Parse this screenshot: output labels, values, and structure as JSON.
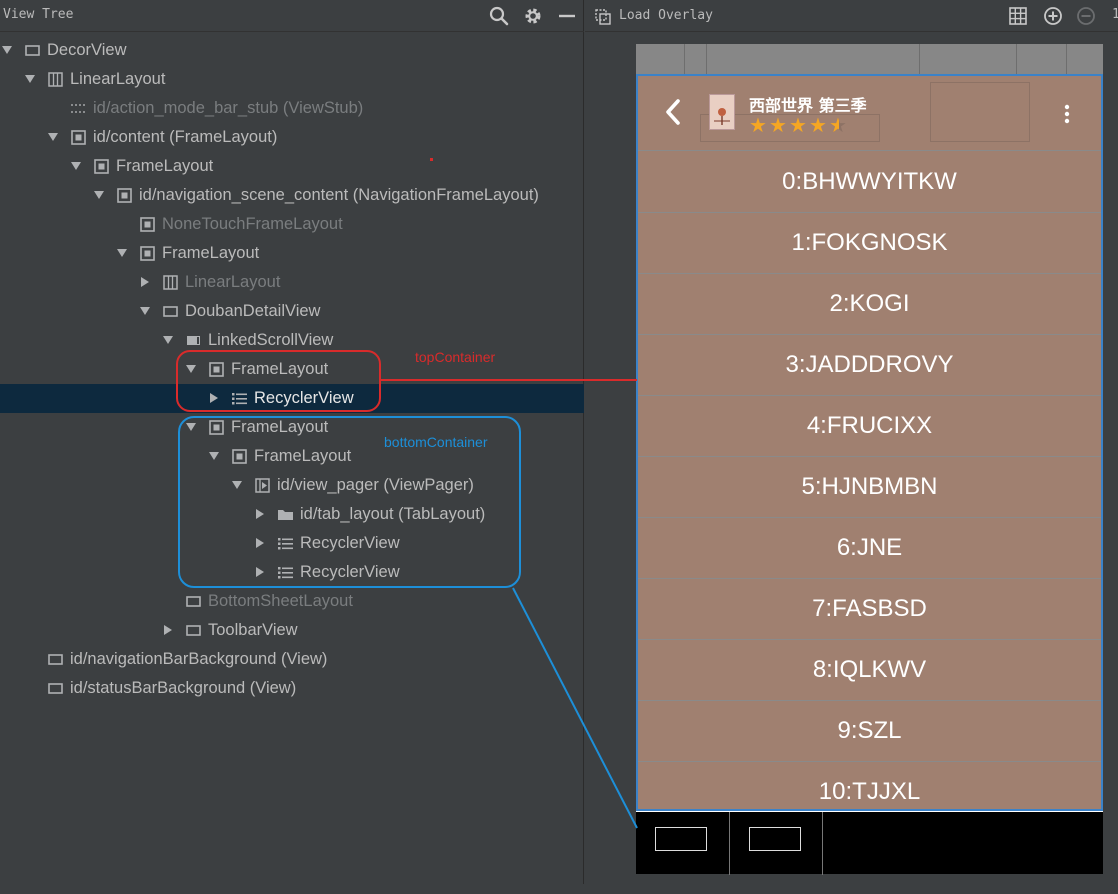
{
  "left_panel": {
    "title": "View Tree",
    "header_icons": [
      "search-icon",
      "gear-icon",
      "minimize-icon"
    ]
  },
  "tree": [
    {
      "label": "DecorView",
      "depth": 0,
      "arrow": "expanded",
      "icon": "view-icon",
      "style": "normal"
    },
    {
      "label": "LinearLayout",
      "depth": 1,
      "arrow": "expanded",
      "icon": "linear-layout-icon",
      "style": "normal"
    },
    {
      "label": "id/action_mode_bar_stub (ViewStub)",
      "depth": 2,
      "arrow": "none",
      "icon": "viewstub-icon",
      "style": "dim"
    },
    {
      "label": "id/content (FrameLayout)",
      "depth": 2,
      "arrow": "expanded",
      "icon": "frame-layout-icon",
      "style": "normal"
    },
    {
      "label": "FrameLayout",
      "depth": 3,
      "arrow": "expanded",
      "icon": "frame-layout-icon",
      "style": "normal"
    },
    {
      "label": "id/navigation_scene_content (NavigationFrameLayout)",
      "depth": 4,
      "arrow": "expanded",
      "icon": "frame-layout-icon",
      "style": "normal"
    },
    {
      "label": "NoneTouchFrameLayout",
      "depth": 5,
      "arrow": "none",
      "icon": "frame-layout-icon",
      "style": "dim"
    },
    {
      "label": "FrameLayout",
      "depth": 5,
      "arrow": "expanded",
      "icon": "frame-layout-icon",
      "style": "normal"
    },
    {
      "label": "LinearLayout",
      "depth": 6,
      "arrow": "collapsed",
      "icon": "linear-layout-icon",
      "style": "dim"
    },
    {
      "label": "DoubanDetailView",
      "depth": 6,
      "arrow": "expanded",
      "icon": "view-icon",
      "style": "normal"
    },
    {
      "label": "LinkedScrollView",
      "depth": 7,
      "arrow": "expanded",
      "icon": "scroll-view-icon",
      "style": "normal"
    },
    {
      "label": "FrameLayout",
      "depth": 8,
      "arrow": "expanded",
      "icon": "frame-layout-icon",
      "style": "normal"
    },
    {
      "label": "RecyclerView",
      "depth": 9,
      "arrow": "collapsed",
      "icon": "list-icon",
      "style": "bright",
      "selected": true
    },
    {
      "label": "FrameLayout",
      "depth": 8,
      "arrow": "expanded",
      "icon": "frame-layout-icon",
      "style": "normal"
    },
    {
      "label": "FrameLayout",
      "depth": 9,
      "arrow": "expanded",
      "icon": "frame-layout-icon",
      "style": "normal"
    },
    {
      "label": "id/view_pager (ViewPager)",
      "depth": 10,
      "arrow": "expanded",
      "icon": "view-pager-icon",
      "style": "normal"
    },
    {
      "label": "id/tab_layout (TabLayout)",
      "depth": 11,
      "arrow": "collapsed",
      "icon": "folder-icon",
      "style": "normal"
    },
    {
      "label": "RecyclerView",
      "depth": 11,
      "arrow": "collapsed",
      "icon": "list-icon",
      "style": "normal"
    },
    {
      "label": "RecyclerView",
      "depth": 11,
      "arrow": "collapsed",
      "icon": "list-icon",
      "style": "normal"
    },
    {
      "label": "BottomSheetLayout",
      "depth": 7,
      "arrow": "none",
      "icon": "view-icon",
      "style": "dim"
    },
    {
      "label": "ToolbarView",
      "depth": 7,
      "arrow": "collapsed",
      "icon": "view-icon",
      "style": "normal"
    },
    {
      "label": "id/navigationBarBackground (View)",
      "depth": 1,
      "arrow": "none",
      "icon": "view-icon",
      "style": "normal"
    },
    {
      "label": "id/statusBarBackground (View)",
      "depth": 1,
      "arrow": "none",
      "icon": "view-icon",
      "style": "normal"
    }
  ],
  "annotations": {
    "top": {
      "label": "topContainer",
      "color": "#d92b2b"
    },
    "bottom": {
      "label": "bottomContainer",
      "color": "#1d8fd8"
    }
  },
  "right_panel": {
    "load_overlay_label": "Load Overlay",
    "header_icons": [
      "grid-icon",
      "zoom-in-icon",
      "zoom-out-icon"
    ],
    "zoom_indicator": "1"
  },
  "app": {
    "movie_title": "西部世界 第三季",
    "rating": 4.5,
    "rating_max": 5,
    "star_color": "#f5a623",
    "background": "#a08070",
    "items": [
      "0:BHWWYITKW",
      "1:FOKGNOSK",
      "2:KOGI",
      "3:JADDDROVY",
      "4:FRUCIXX",
      "5:HJNBMBN",
      "6:JNE",
      "7:FASBSD",
      "8:IQLKWV",
      "9:SZL",
      "10:TJJXL"
    ]
  }
}
